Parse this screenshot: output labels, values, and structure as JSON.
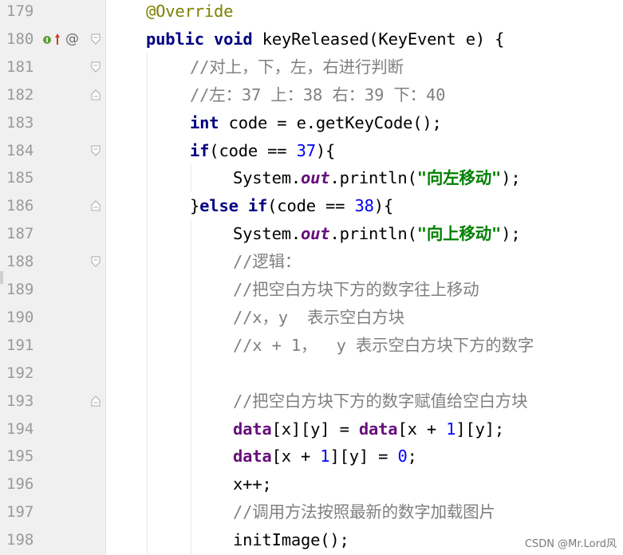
{
  "editor": {
    "lines": [
      {
        "num": "179",
        "tokens": [
          {
            "t": "ann",
            "v": "@Override"
          }
        ]
      },
      {
        "num": "180",
        "tokens": [
          {
            "t": "kw",
            "v": "public "
          },
          {
            "t": "kw",
            "v": "void "
          },
          {
            "t": "plain",
            "v": "keyReleased(KeyEvent e) {"
          }
        ]
      },
      {
        "num": "181",
        "tokens": [
          {
            "t": "cm",
            "v": "//对上，下，左，右进行判断"
          }
        ]
      },
      {
        "num": "182",
        "tokens": [
          {
            "t": "cm",
            "v": "//左：37 上：38 右：39 下：40"
          }
        ]
      },
      {
        "num": "183",
        "tokens": [
          {
            "t": "kw",
            "v": "int "
          },
          {
            "t": "plain",
            "v": "code = e.getKeyCode();"
          }
        ]
      },
      {
        "num": "184",
        "tokens": [
          {
            "t": "kw",
            "v": "if"
          },
          {
            "t": "plain",
            "v": "(code == "
          },
          {
            "t": "num",
            "v": "37"
          },
          {
            "t": "plain",
            "v": "){"
          }
        ]
      },
      {
        "num": "185",
        "tokens": [
          {
            "t": "plain",
            "v": "System."
          },
          {
            "t": "fld",
            "v": "out"
          },
          {
            "t": "plain",
            "v": ".println("
          },
          {
            "t": "str",
            "v": "\"向左移动\""
          },
          {
            "t": "plain",
            "v": ");"
          }
        ]
      },
      {
        "num": "186",
        "tokens": [
          {
            "t": "plain",
            "v": "}"
          },
          {
            "t": "kw",
            "v": "else if"
          },
          {
            "t": "plain",
            "v": "(code == "
          },
          {
            "t": "num",
            "v": "38"
          },
          {
            "t": "plain",
            "v": "){"
          }
        ]
      },
      {
        "num": "187",
        "tokens": [
          {
            "t": "plain",
            "v": "System."
          },
          {
            "t": "fld",
            "v": "out"
          },
          {
            "t": "plain",
            "v": ".println("
          },
          {
            "t": "str",
            "v": "\"向上移动\""
          },
          {
            "t": "plain",
            "v": ");"
          }
        ]
      },
      {
        "num": "188",
        "tokens": [
          {
            "t": "cm",
            "v": "//逻辑："
          }
        ]
      },
      {
        "num": "189",
        "tokens": [
          {
            "t": "cm",
            "v": "//把空白方块下方的数字往上移动"
          }
        ]
      },
      {
        "num": "190",
        "tokens": [
          {
            "t": "cm",
            "v": "//x，y  表示空白方块"
          }
        ]
      },
      {
        "num": "191",
        "tokens": [
          {
            "t": "cm",
            "v": "//x + 1，  y 表示空白方块下方的数字"
          }
        ]
      },
      {
        "num": "192",
        "tokens": []
      },
      {
        "num": "193",
        "tokens": [
          {
            "t": "cm",
            "v": "//把空白方块下方的数字赋值给空白方块"
          }
        ]
      },
      {
        "num": "194",
        "tokens": [
          {
            "t": "fld2",
            "v": "data"
          },
          {
            "t": "plain",
            "v": "[x][y] = "
          },
          {
            "t": "fld2",
            "v": "data"
          },
          {
            "t": "plain",
            "v": "[x + "
          },
          {
            "t": "num",
            "v": "1"
          },
          {
            "t": "plain",
            "v": "][y];"
          }
        ]
      },
      {
        "num": "195",
        "tokens": [
          {
            "t": "fld2",
            "v": "data"
          },
          {
            "t": "plain",
            "v": "[x + "
          },
          {
            "t": "num",
            "v": "1"
          },
          {
            "t": "plain",
            "v": "][y] = "
          },
          {
            "t": "num",
            "v": "0"
          },
          {
            "t": "plain",
            "v": ";"
          }
        ]
      },
      {
        "num": "196",
        "tokens": [
          {
            "t": "plain",
            "v": "x++;"
          }
        ]
      },
      {
        "num": "197",
        "tokens": [
          {
            "t": "cm",
            "v": "//调用方法按照最新的数字加载图片"
          }
        ]
      },
      {
        "num": "198",
        "tokens": [
          {
            "t": "plain",
            "v": "initImage();"
          }
        ]
      }
    ]
  },
  "gutter": {
    "override_marker": "@"
  },
  "watermark": "CSDN @Mr.Lord风"
}
